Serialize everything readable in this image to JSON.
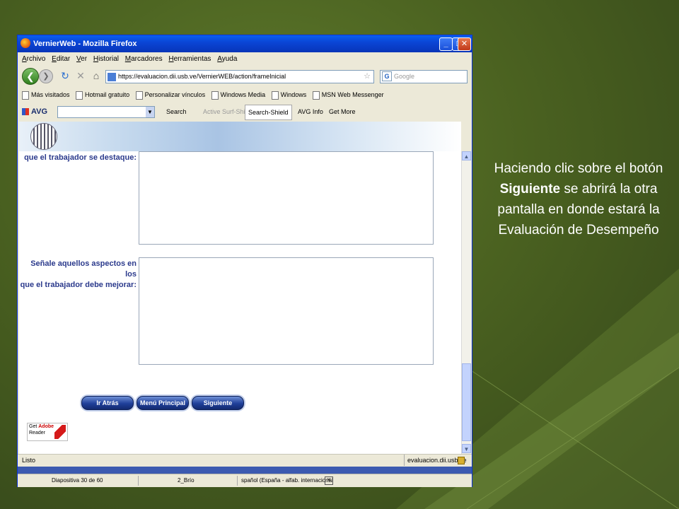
{
  "window": {
    "title": "VernierWeb - Mozilla Firefox",
    "controls": {
      "minimize": "_",
      "maximize": "□",
      "close": "✕"
    }
  },
  "menu": [
    "Archivo",
    "Editar",
    "Ver",
    "Historial",
    "Marcadores",
    "Herramientas",
    "Ayuda"
  ],
  "nav": {
    "url": "https://evaluacion.dii.usb.ve/VernierWEB/action/frameInicial",
    "search_placeholder": "Google"
  },
  "bookmarks": [
    "Más visitados",
    "Hotmail gratuito",
    "Personalizar vínculos",
    "Windows Media",
    "Windows",
    "MSN Web Messenger"
  ],
  "avg_toolbar": {
    "logo": "AVG",
    "search": "Search",
    "active_surf": "Active Surf-Shield",
    "search_shield": "Search-Shield",
    "avg_info": "AVG Info",
    "get_more": "Get More"
  },
  "form": {
    "label1": "que el trabajador se destaque:",
    "label2_line1": "Señale aquellos aspectos en los",
    "label2_line2": "que el trabajador debe mejorar:",
    "buttons": {
      "back": "Ir Atrás",
      "main_menu": "Menú Principal",
      "next": "Siguiente"
    },
    "adobe": {
      "get": "Get",
      "brand": "Adobe",
      "product": "Reader"
    }
  },
  "status": {
    "left": "Listo",
    "host": "evaluacion.dii.usb.ve"
  },
  "ppt_status": {
    "slide": "Diapositiva 30 de 60",
    "design": "2_Brío",
    "language": "spañol (España - alfab. internacional"
  },
  "caption": {
    "before": "Haciendo clic sobre el botón ",
    "bold": "Siguiente",
    "after": " se abrirá la otra pantalla en donde estará la Evaluación de Desempeño"
  },
  "colors": {
    "label": "#2b3a8c",
    "button": "#1f3f99",
    "background": "#4a6120",
    "titlebar": "#0a45d6"
  }
}
